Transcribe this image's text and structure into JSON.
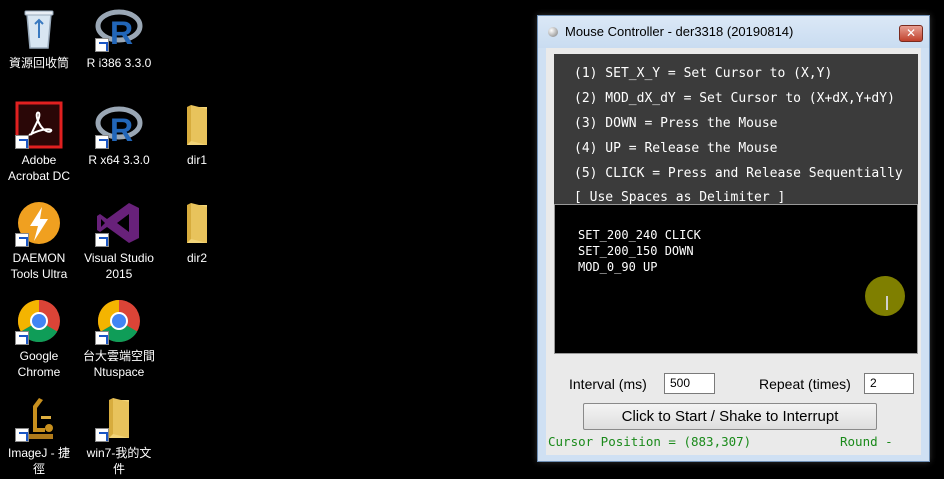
{
  "desktop": {
    "icons": [
      {
        "label": "資源回收筒"
      },
      {
        "label": "R i386 3.3.0"
      },
      {
        "label": "Adobe\nAcrobat DC"
      },
      {
        "label": "R x64 3.3.0"
      },
      {
        "label": "dir1"
      },
      {
        "label": "DAEMON\nTools Ultra"
      },
      {
        "label": "Visual Studio\n2015"
      },
      {
        "label": "dir2"
      },
      {
        "label": "Google\nChrome"
      },
      {
        "label": "台大雲端空間\nNtuspace"
      },
      {
        "label": "ImageJ - 捷\n徑"
      },
      {
        "label": "win7-我的文\n件"
      }
    ]
  },
  "window": {
    "title": "Mouse Controller - der3318 (20190814)",
    "close_label": "✕",
    "help_lines": [
      "(1) SET_X_Y = Set Cursor to (X,Y)",
      "(2) MOD_dX_dY = Set Cursor to (X+dX,Y+dY)",
      "(3) DOWN = Press the Mouse",
      "(4) UP = Release the Mouse",
      "(5) CLICK = Press and Release Sequentially",
      "[ Use Spaces as Delimiter ]"
    ],
    "script_text": "SET_200_240 CLICK\nSET_200_150 DOWN\nMOD_0_90 UP",
    "interval_label": "Interval (ms)",
    "interval_value": "500",
    "repeat_label": "Repeat (times)",
    "repeat_value": "2",
    "start_button_label": "Click to Start / Shake to Interrupt",
    "status_position": "Cursor Position = (883,307)",
    "status_round": "Round -"
  },
  "colors": {
    "help_bg": "#3b3b3b",
    "status_text": "#1a8a1a",
    "cursor_highlight": "#7f7f00"
  }
}
